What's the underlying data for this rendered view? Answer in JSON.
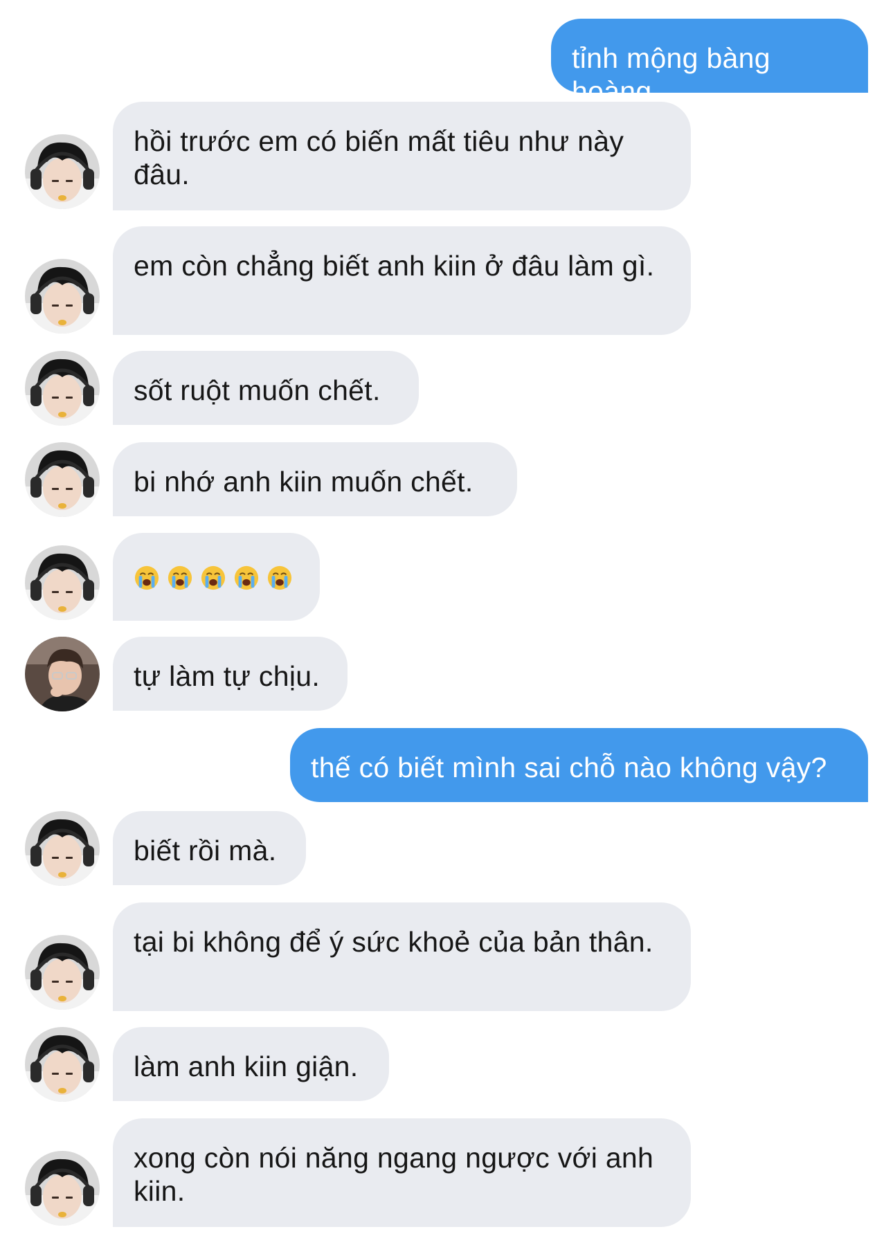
{
  "colors": {
    "outgoing_bubble": "#4299ec",
    "incoming_bubble": "#e9ebf0",
    "incoming_text": "#161616",
    "outgoing_text": "#ffffff"
  },
  "messages": [
    {
      "sender": "me",
      "text": "tỉnh mộng bàng hoàng."
    },
    {
      "sender": "bi",
      "avatar": "avatar-bi-headphones",
      "text": "hồi trước em có biến mất tiêu như này đâu."
    },
    {
      "sender": "bi",
      "avatar": "avatar-bi-headphones",
      "text": "em còn chẳng biết anh kiin ở đâu làm gì."
    },
    {
      "sender": "bi",
      "avatar": "avatar-bi-headphones",
      "text": "sốt ruột muốn chết."
    },
    {
      "sender": "bi",
      "avatar": "avatar-bi-headphones",
      "text": "bi nhớ anh kiin muốn chết."
    },
    {
      "sender": "bi",
      "avatar": "avatar-bi-headphones",
      "emoji": [
        "loudly-crying-face-emoji",
        "loudly-crying-face-emoji",
        "loudly-crying-face-emoji",
        "loudly-crying-face-emoji",
        "loudly-crying-face-emoji"
      ]
    },
    {
      "sender": "kiin",
      "avatar": "avatar-kiin-glasses",
      "text": "tự làm tự chịu."
    },
    {
      "sender": "me",
      "text": "thế có biết mình sai chỗ nào không vậy?"
    },
    {
      "sender": "bi",
      "avatar": "avatar-bi-headphones",
      "text": "biết rồi mà."
    },
    {
      "sender": "bi",
      "avatar": "avatar-bi-headphones",
      "text": "tại bi không để ý sức khoẻ của bản thân."
    },
    {
      "sender": "bi",
      "avatar": "avatar-bi-headphones",
      "text": "làm anh kiin giận."
    },
    {
      "sender": "bi",
      "avatar": "avatar-bi-headphones",
      "text": "xong còn nói năng ngang ngược với anh kiin."
    }
  ]
}
